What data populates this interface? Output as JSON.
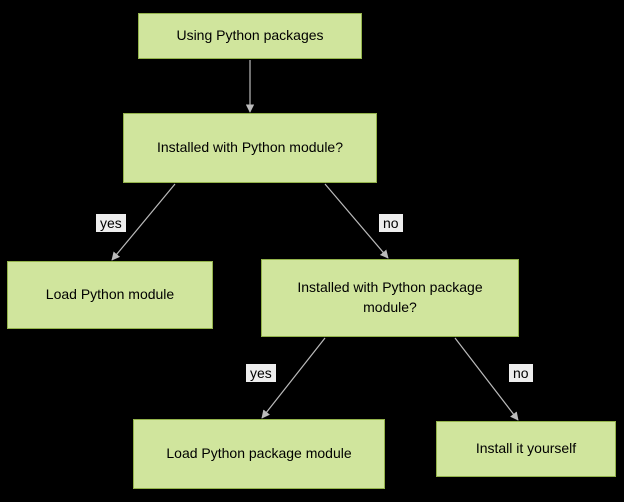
{
  "chart_data": {
    "type": "flowchart",
    "nodes": [
      {
        "id": "root",
        "label": "Using Python packages"
      },
      {
        "id": "q1",
        "label": "Installed with Python module?"
      },
      {
        "id": "a_yes1",
        "label": "Load Python module"
      },
      {
        "id": "q2",
        "label": "Installed with Python package module?"
      },
      {
        "id": "a_yes2",
        "label": "Load Python package module"
      },
      {
        "id": "a_no2",
        "label": "Install it yourself"
      }
    ],
    "edges": [
      {
        "from": "root",
        "to": "q1",
        "label": ""
      },
      {
        "from": "q1",
        "to": "a_yes1",
        "label": "yes"
      },
      {
        "from": "q1",
        "to": "q2",
        "label": "no"
      },
      {
        "from": "q2",
        "to": "a_yes2",
        "label": "yes"
      },
      {
        "from": "q2",
        "to": "a_no2",
        "label": "no"
      }
    ]
  }
}
